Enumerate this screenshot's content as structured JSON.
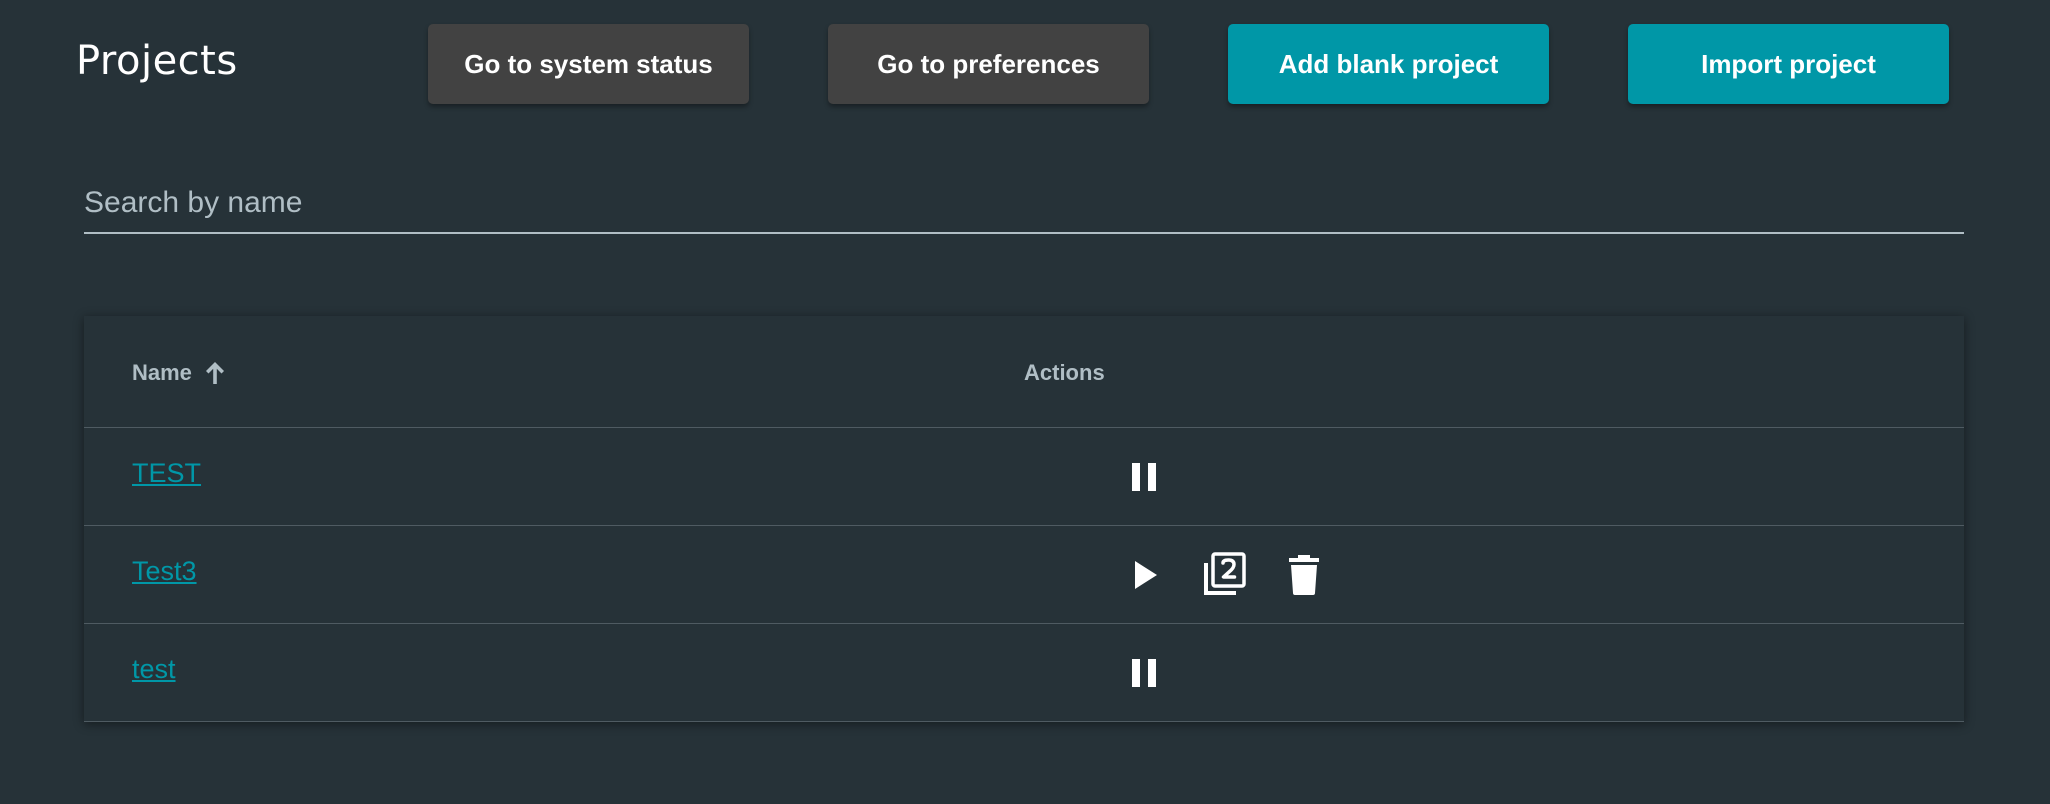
{
  "header": {
    "title": "Projects",
    "buttons": {
      "system_status": "Go to system status",
      "preferences": "Go to preferences",
      "add_blank": "Add blank project",
      "import": "Import project"
    }
  },
  "search": {
    "placeholder": "Search by name",
    "value": ""
  },
  "table": {
    "columns": {
      "name": "Name",
      "actions": "Actions"
    },
    "sort": {
      "column": "name",
      "direction": "ascending",
      "icon": "arrow-up-icon"
    },
    "rows": [
      {
        "name": "TEST",
        "actions": [
          "pause-icon"
        ]
      },
      {
        "name": "Test3",
        "actions": [
          "play-icon",
          "copy-icon",
          "delete-icon"
        ]
      },
      {
        "name": "test",
        "actions": [
          "pause-icon"
        ]
      }
    ]
  },
  "colors": {
    "background": "#263238",
    "accent": "#0097a7",
    "secondary_button": "#424242",
    "header_text": "#b0bec5"
  }
}
